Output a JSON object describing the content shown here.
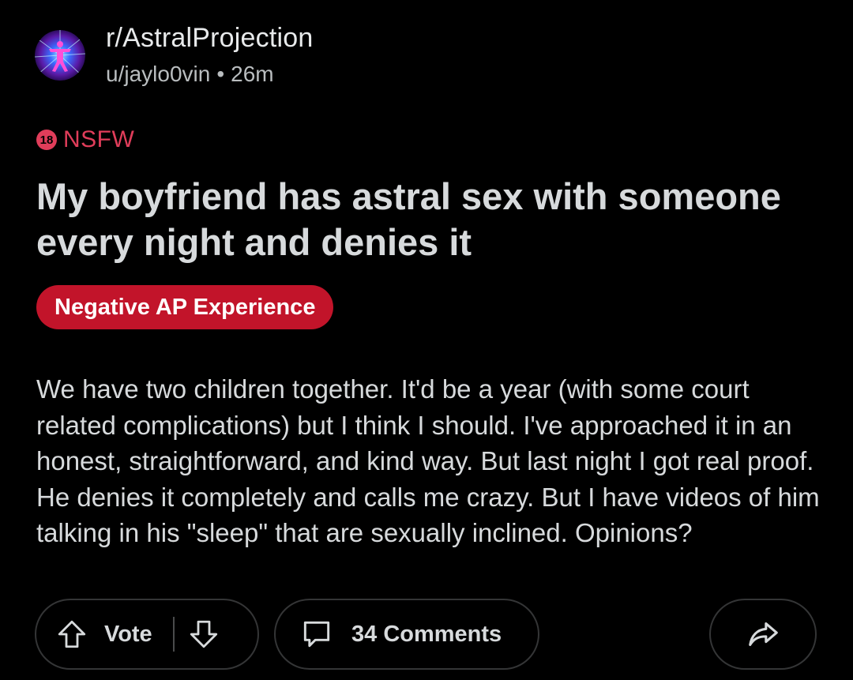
{
  "header": {
    "subreddit": "r/AstralProjection",
    "author": "u/jaylo0vin",
    "separator": "•",
    "time": "26m"
  },
  "nsfw": {
    "badge": "18",
    "label": "NSFW",
    "color": "#e03d5a"
  },
  "post": {
    "title": "My boyfriend has astral sex with someone every night and denies it",
    "flair": "Negative AP Experience",
    "flair_color": "#c2142a",
    "body": "We have two children together. It'd be a year (with some court related complications) but I think I should. I've approached it in an honest, straightforward, and kind way. But last night I got real proof. He denies it completely and calls me crazy. But I have videos of him talking in his \"sleep\" that are sexually inclined. Opinions?"
  },
  "actions": {
    "vote_label": "Vote",
    "comments_label": "34 Comments",
    "upvote_icon": "arrow-up-icon",
    "downvote_icon": "arrow-down-icon",
    "comment_icon": "comment-bubble-icon",
    "share_icon": "share-arrow-icon"
  },
  "colors": {
    "background": "#000000",
    "text": "#d7dadc",
    "border": "#343536"
  }
}
